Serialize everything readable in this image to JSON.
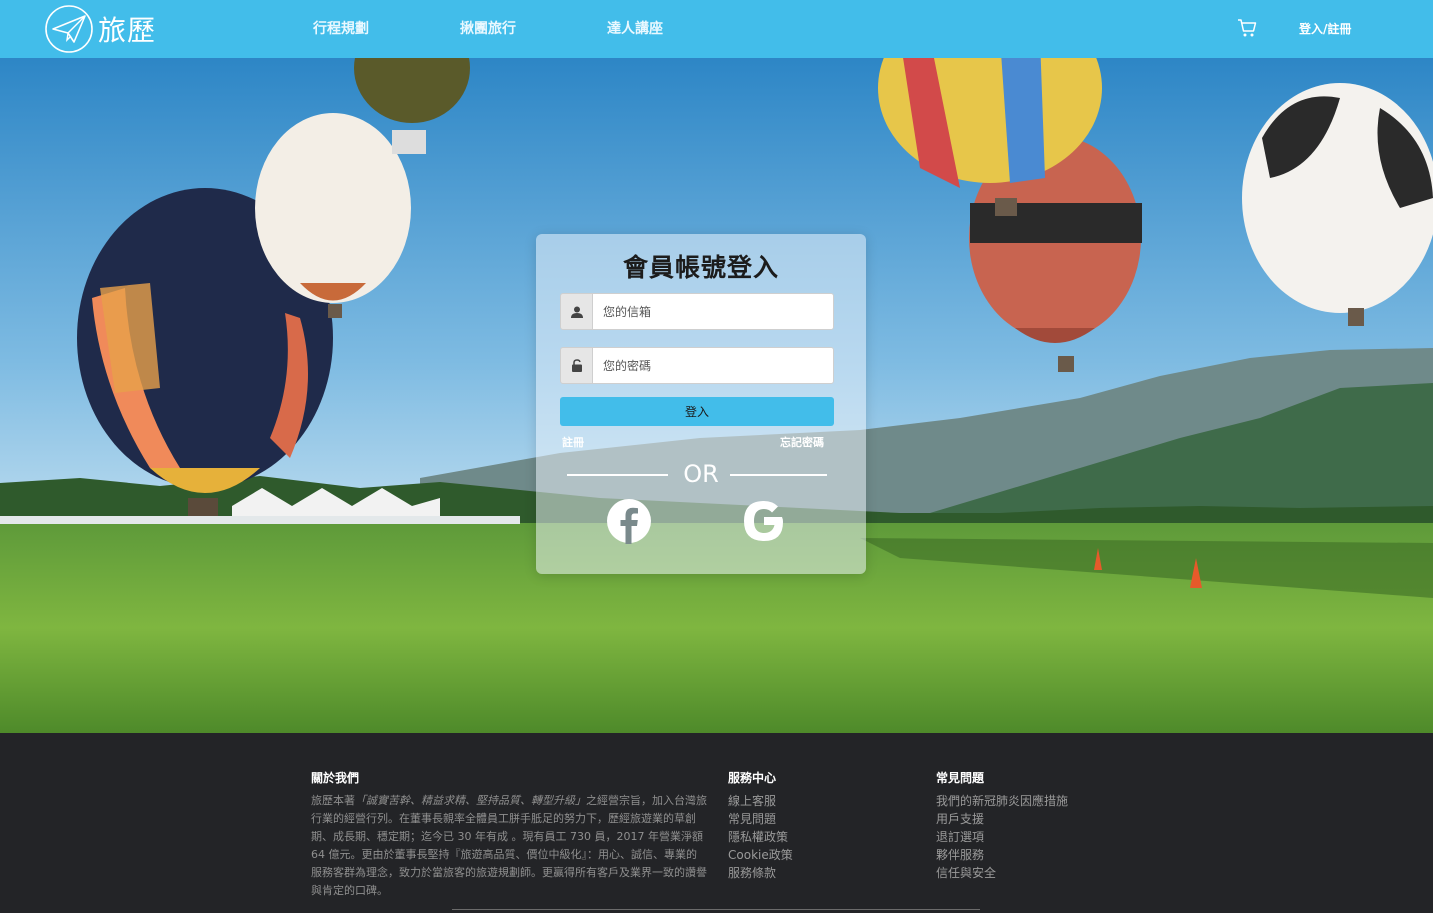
{
  "brand": {
    "name": "旅歷"
  },
  "nav": {
    "links": [
      "行程規劃",
      "揪團旅行",
      "達人講座"
    ],
    "login_label": "登入/註冊"
  },
  "login": {
    "title": "會員帳號登入",
    "email_placeholder": "您的信箱",
    "password_placeholder": "您的密碼",
    "submit_label": "登入",
    "register_label": "註冊",
    "forgot_label": "忘記密碼",
    "or_label": "OR"
  },
  "footer": {
    "about": {
      "heading": "關於我們",
      "text_pre": "旅歷本著",
      "text_em": "「誠實苦幹、精益求精、堅持品質、轉型升級」",
      "text_post": "之經營宗旨，加入台灣旅行業的經營行列。在董事長親率全體員工胼手胝足的努力下，歷經旅遊業的草創期、成長期、穩定期；迄今已 30 年有成 。現有員工 730 員，2017 年營業淨額 64 億元。更由於董事長堅持『旅遊高品質、價位中級化』：用心、誠信、專業的服務客群為理念，致力於當旅客的旅遊規劃師。更贏得所有客戶及業界一致的讚譽與肯定的口碑。"
    },
    "service": {
      "heading": "服務中心",
      "items": [
        "線上客服",
        "常見問題",
        "隱私權政策",
        "Cookie政策",
        "服務條款"
      ]
    },
    "faq": {
      "heading": "常見問題",
      "items": [
        "我們的新冠肺炎因應措施",
        "用戶支援",
        "退訂選項",
        "夥伴服務",
        "信任與安全"
      ]
    }
  },
  "colors": {
    "brand": "#42bdea",
    "footer_bg": "#232427"
  }
}
